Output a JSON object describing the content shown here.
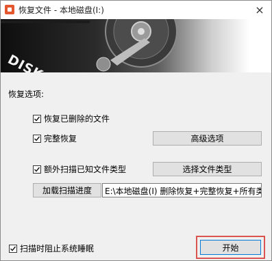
{
  "window": {
    "title": "恢复文件 - 本地磁盘(I:)",
    "close_glyph": "×",
    "app_icon": "diskgenius-app-icon",
    "banner_logo": "DISKGENIUS"
  },
  "section_label": "恢复选项:",
  "options": {
    "recover_deleted": {
      "label": "恢复已删除的文件",
      "checked": true
    },
    "full_recover": {
      "label": "完整恢复",
      "checked": true
    },
    "extra_scan": {
      "label": "额外扫描已知文件类型",
      "checked": true
    },
    "prevent_sleep": {
      "label": "扫描时阻止系统睡眠",
      "checked": true
    }
  },
  "buttons": {
    "advanced": "高级选项",
    "select_types": "选择文件类型",
    "load_progress": "加载扫描进度",
    "start": "开始"
  },
  "progress_path": "E:\\本地磁盘(I) 删除恢复+完整恢复+所有类型",
  "colors": {
    "highlight_border": "#d9534f",
    "focus_border": "#0078d7",
    "button_face": "#e1e1e1"
  }
}
